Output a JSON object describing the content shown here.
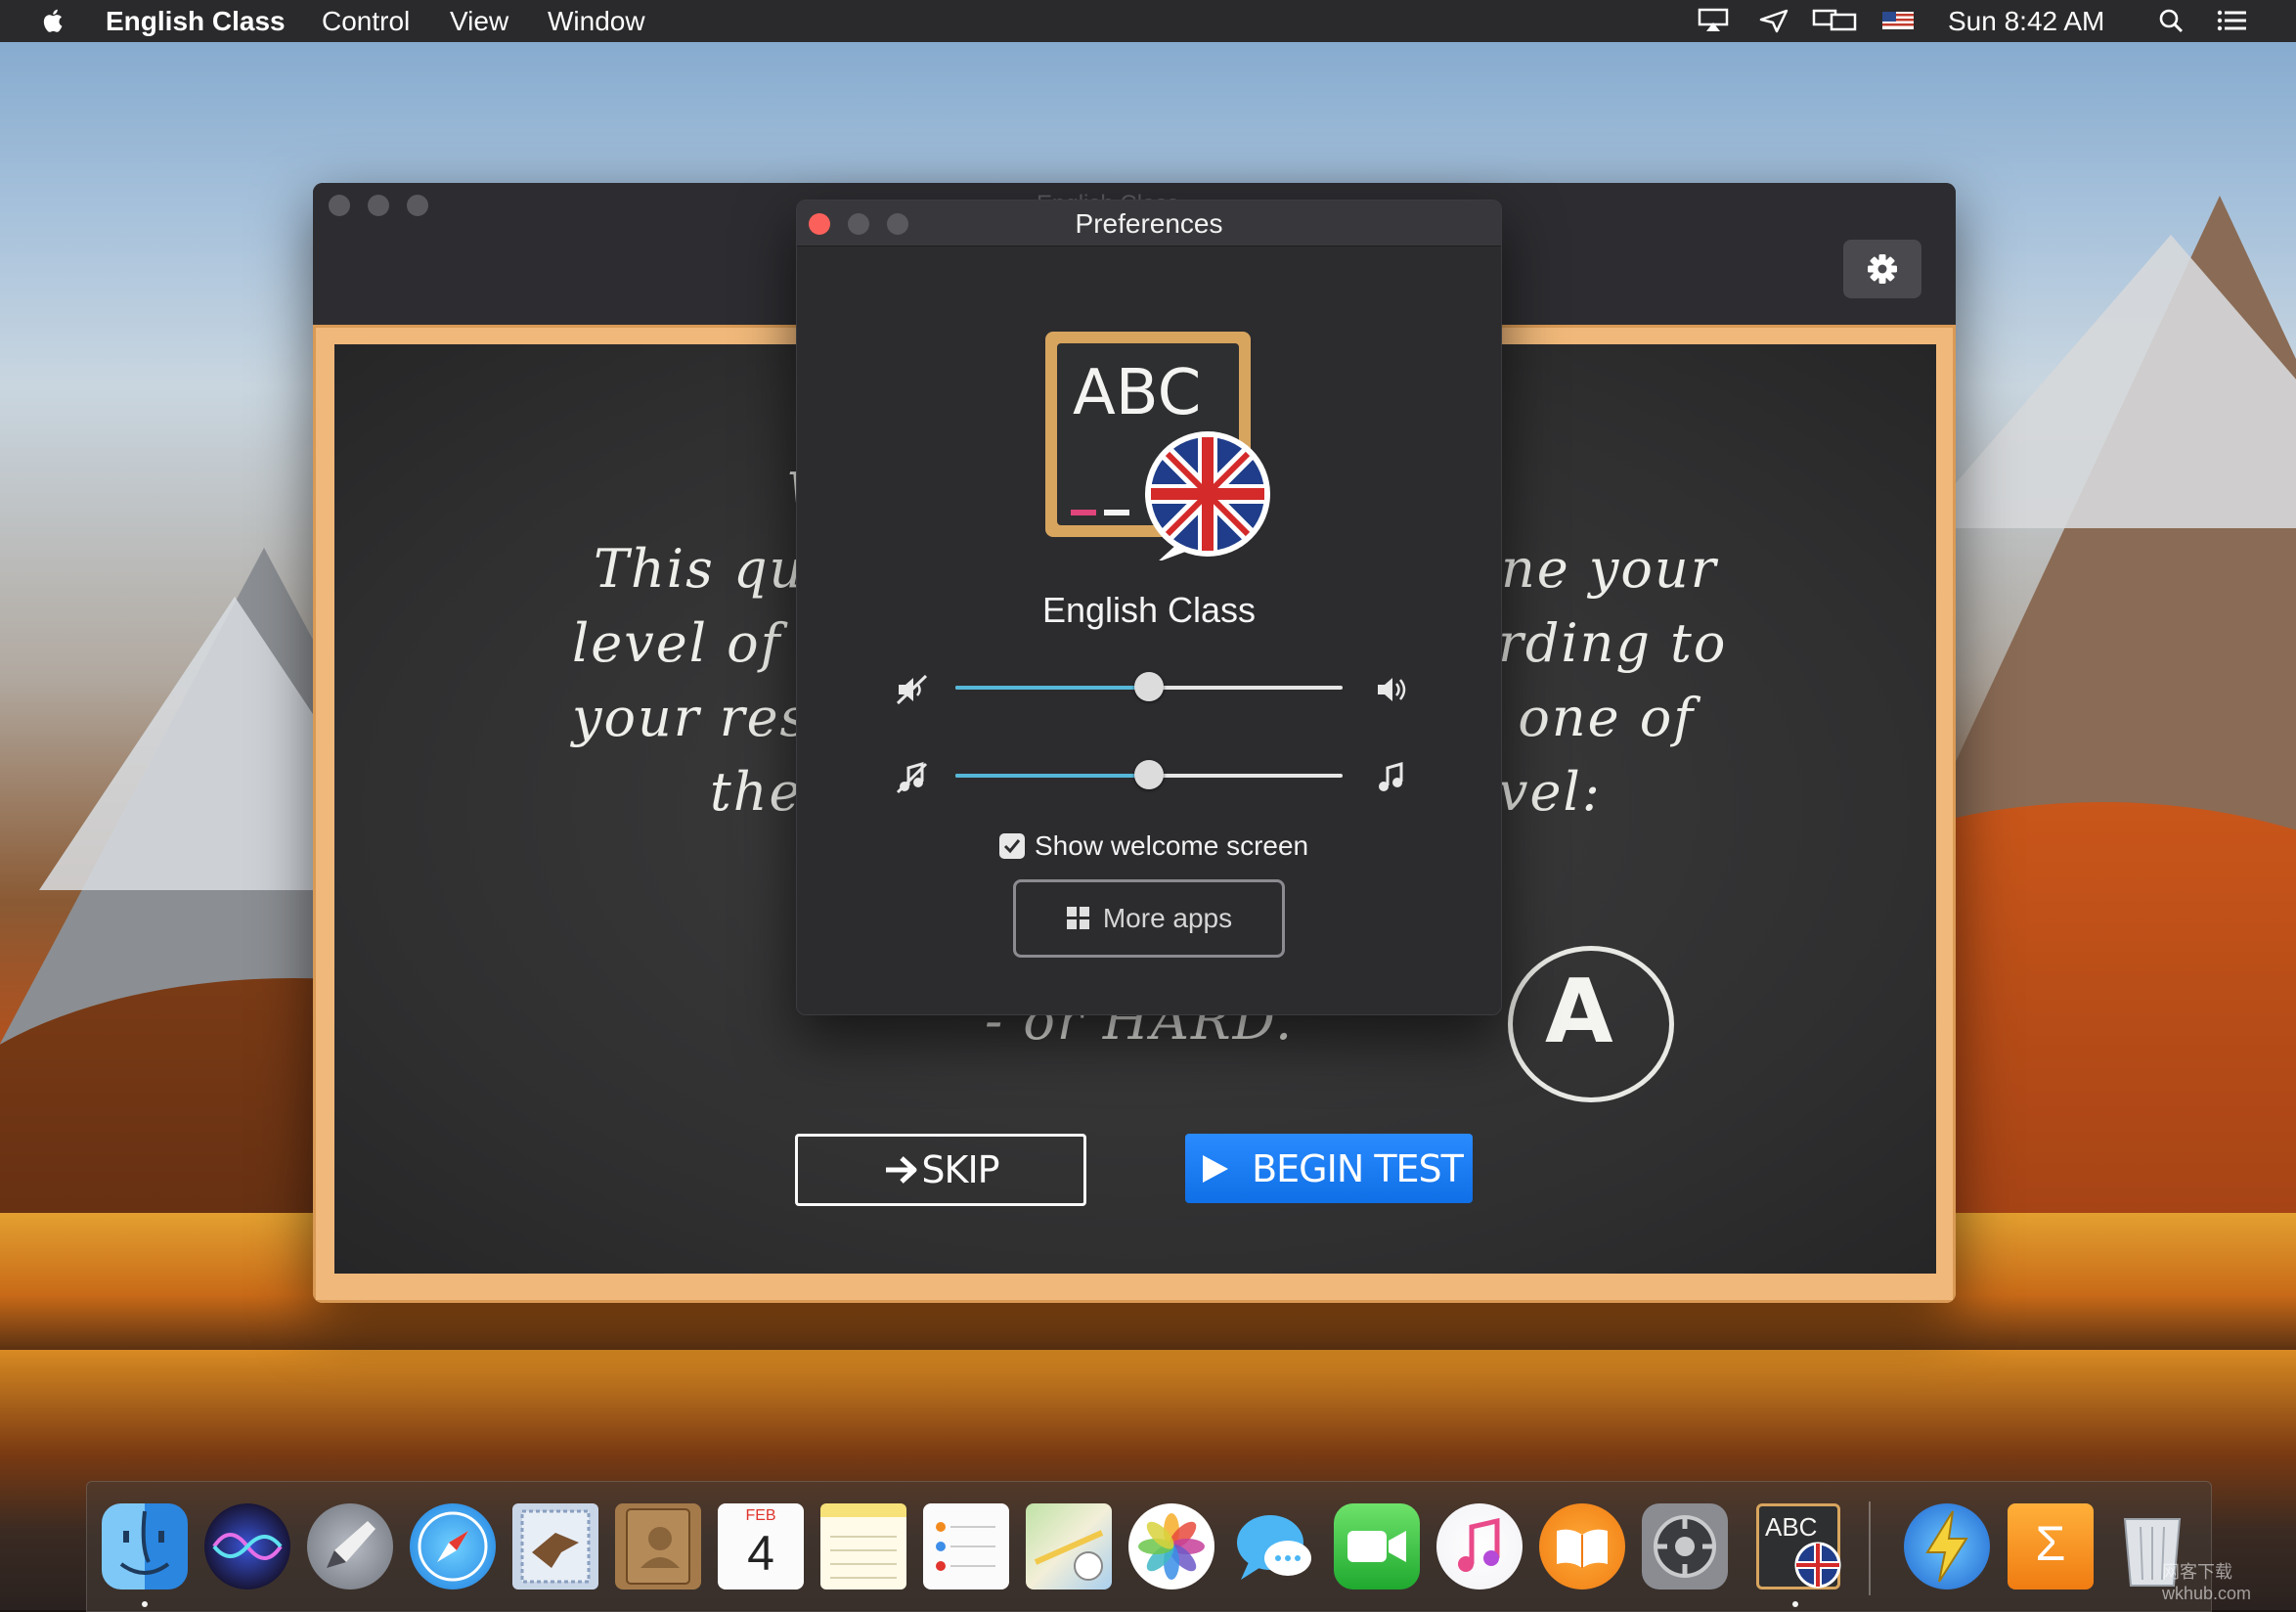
{
  "menubar": {
    "app_name": "English Class",
    "menus": [
      "Control",
      "View",
      "Window"
    ],
    "clock": "Sun 8:42 AM",
    "status_icons": [
      "airplay-icon",
      "paper-plane-icon",
      "display-mirror-icon",
      "us-flag-icon",
      "search-icon",
      "notification-center-icon"
    ]
  },
  "main_window": {
    "title": "English Class",
    "board": {
      "lines": [
        {
          "left": "This qui",
          "right": "ne your"
        },
        {
          "left": "level of",
          "right": "rding to"
        },
        {
          "left": "your resu",
          "right": ". one of"
        },
        {
          "left": "the",
          "right": "vel:"
        }
      ],
      "top_fragment": "W",
      "bottom_text": "- or HARD.",
      "grade_letter": "A"
    },
    "skip_label": "SKIP",
    "begin_label": "BEGIN TEST"
  },
  "preferences": {
    "title": "Preferences",
    "app_icon_text": "ABC",
    "app_name": "English Class",
    "volume_level": 0.5,
    "music_level": 0.5,
    "show_welcome_checked": true,
    "show_welcome_label": "Show welcome screen",
    "more_apps_label": "More apps"
  },
  "dock": {
    "items": [
      "Finder",
      "Siri",
      "Launchpad",
      "Safari",
      "Mail",
      "Contacts",
      "Calendar",
      "Notes",
      "Reminders",
      "Maps",
      "Photos",
      "Messages",
      "FaceTime",
      "iTunes",
      "iBooks",
      "System Preferences",
      "English Class",
      "Some Utility",
      "Sigma App",
      "Trash"
    ],
    "calendar_month": "FEB",
    "calendar_day": "4",
    "english_class_badge": "ABC",
    "sigma_symbol": "Σ"
  },
  "watermark": "网客下载 wkhub.com"
}
